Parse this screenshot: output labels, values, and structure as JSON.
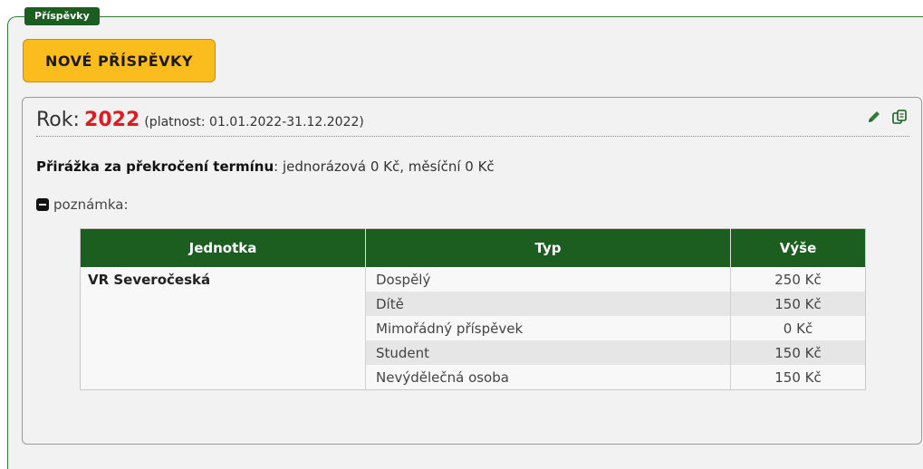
{
  "legend": "Příspěvky",
  "new_button_label": "NOVÉ PŘÍSPĚVKY",
  "year_card": {
    "rok_label": "Rok:",
    "year": "2022",
    "validity": "(platnost: 01.01.2022-31.12.2022)",
    "icons": [
      "pencil-icon",
      "copy-icon"
    ],
    "surcharge_label": "Přirážka za překročení termínu",
    "surcharge_value": ": jednorázová 0 Kč, měsíční 0 Kč",
    "note_label": "poznámka:"
  },
  "table": {
    "headers": [
      "Jednotka",
      "Typ",
      "Výše"
    ],
    "unit": "VR Severočeská",
    "rows": [
      {
        "typ": "Dospělý",
        "amount": "250 Kč"
      },
      {
        "typ": "Dítě",
        "amount": "150 Kč"
      },
      {
        "typ": "Mimořádný příspěvek",
        "amount": "0 Kč"
      },
      {
        "typ": "Student",
        "amount": "150 Kč"
      },
      {
        "typ": "Nevýdělečná osoba",
        "amount": "150 Kč"
      }
    ]
  },
  "colors": {
    "accent_green": "#1b5e20",
    "button_yellow": "#fbbd1e",
    "year_red": "#e01b24"
  }
}
